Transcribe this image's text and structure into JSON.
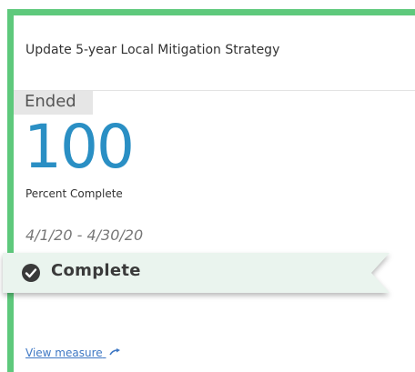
{
  "card": {
    "title": "Update 5-year Local Mitigation Strategy",
    "status_chip": "Ended",
    "value": "100",
    "metric_label": "Percent Complete",
    "date_range": "4/1/20 - 4/30/20",
    "ribbon_status": "Complete",
    "ribbon_icon": "check-circle-icon",
    "view_link": "View measure",
    "view_link_icon": "arrow-right-icon"
  },
  "colors": {
    "accent": "#5ec97c",
    "value": "#2a8fc4",
    "ribbon_bg": "#eaf4ee",
    "link": "#3f78c4"
  }
}
